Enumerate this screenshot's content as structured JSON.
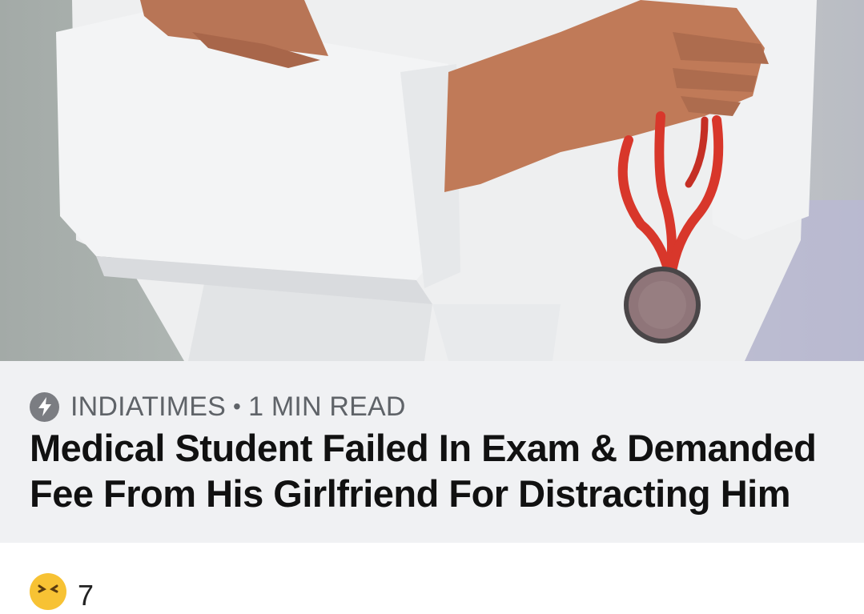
{
  "article": {
    "image_subject": "doctor-in-white-coat-holding-red-stethoscope",
    "source": "INDIATIMES",
    "separator": "•",
    "read_time": "1 MIN READ",
    "headline": "Medical Student Failed In Exam & Demanded Fee From His Girlfriend For Distracting Him",
    "icon": "amp-lightning-icon"
  },
  "reactions": {
    "emoji": "laughing-face-emoji",
    "count": "7"
  },
  "colors": {
    "meta_background": "#f0f1f3",
    "source_text": "#5f6368",
    "headline_text": "#111111",
    "stethoscope": "#d8372b"
  }
}
